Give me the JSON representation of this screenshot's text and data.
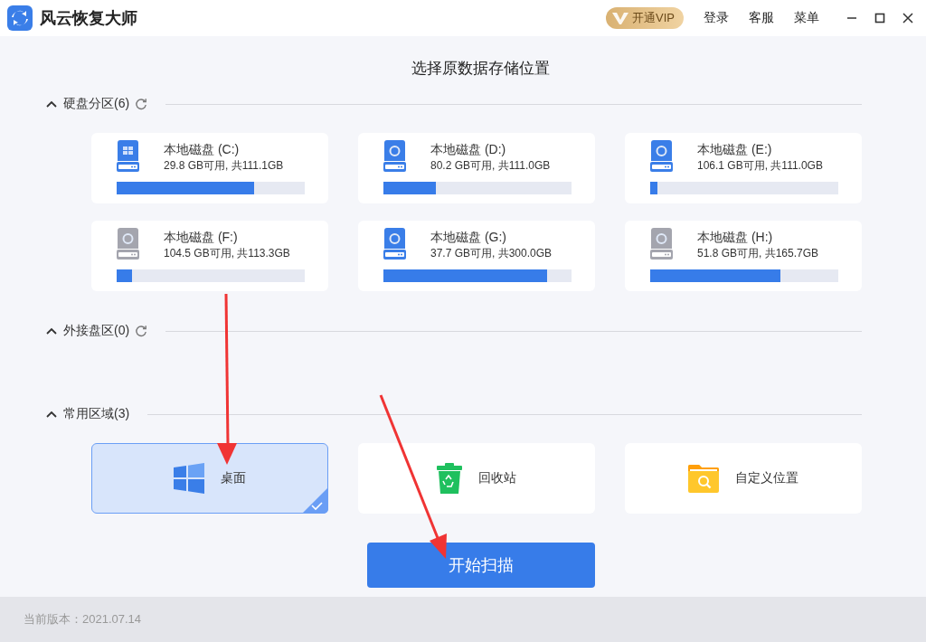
{
  "app": {
    "title": "风云恢复大师",
    "vip_button": "开通VIP",
    "menu": [
      "登录",
      "客服",
      "菜单"
    ]
  },
  "heading": "选择原数据存储位置",
  "sections": [
    {
      "title": "硬盘分区(6)",
      "expanded": true,
      "refreshable": true,
      "drives": [
        {
          "name": "本地磁盘 (C:)",
          "space": "29.8 GB可用, 共111.1GB",
          "level": 0.73,
          "kind": "system"
        },
        {
          "name": "本地磁盘 (D:)",
          "space": "80.2 GB可用, 共111.0GB",
          "level": 0.28,
          "kind": "data"
        },
        {
          "name": "本地磁盘 (E:)",
          "space": "106.1 GB可用, 共111.0GB",
          "level": 0.04,
          "kind": "data"
        },
        {
          "name": "本地磁盘 (F:)",
          "space": "104.5 GB可用, 共113.3GB",
          "level": 0.08,
          "kind": "inactive"
        },
        {
          "name": "本地磁盘 (G:)",
          "space": "37.7 GB可用, 共300.0GB",
          "level": 0.87,
          "kind": "data"
        },
        {
          "name": "本地磁盘 (H:)",
          "space": "51.8 GB可用, 共165.7GB",
          "level": 0.69,
          "kind": "inactive"
        }
      ]
    },
    {
      "title": "外接盘区(0)",
      "expanded": true,
      "refreshable": true
    },
    {
      "title": "常用区域(3)",
      "expanded": true,
      "refreshable": false,
      "locations": [
        {
          "name": "桌面",
          "kind": "desktop",
          "selected": true
        },
        {
          "name": "回收站",
          "kind": "recycle",
          "selected": false
        },
        {
          "name": "自定义位置",
          "kind": "custom",
          "selected": false
        }
      ]
    }
  ],
  "start_button": "开始扫描",
  "footer": {
    "version": "当前版本：2021.07.14"
  }
}
